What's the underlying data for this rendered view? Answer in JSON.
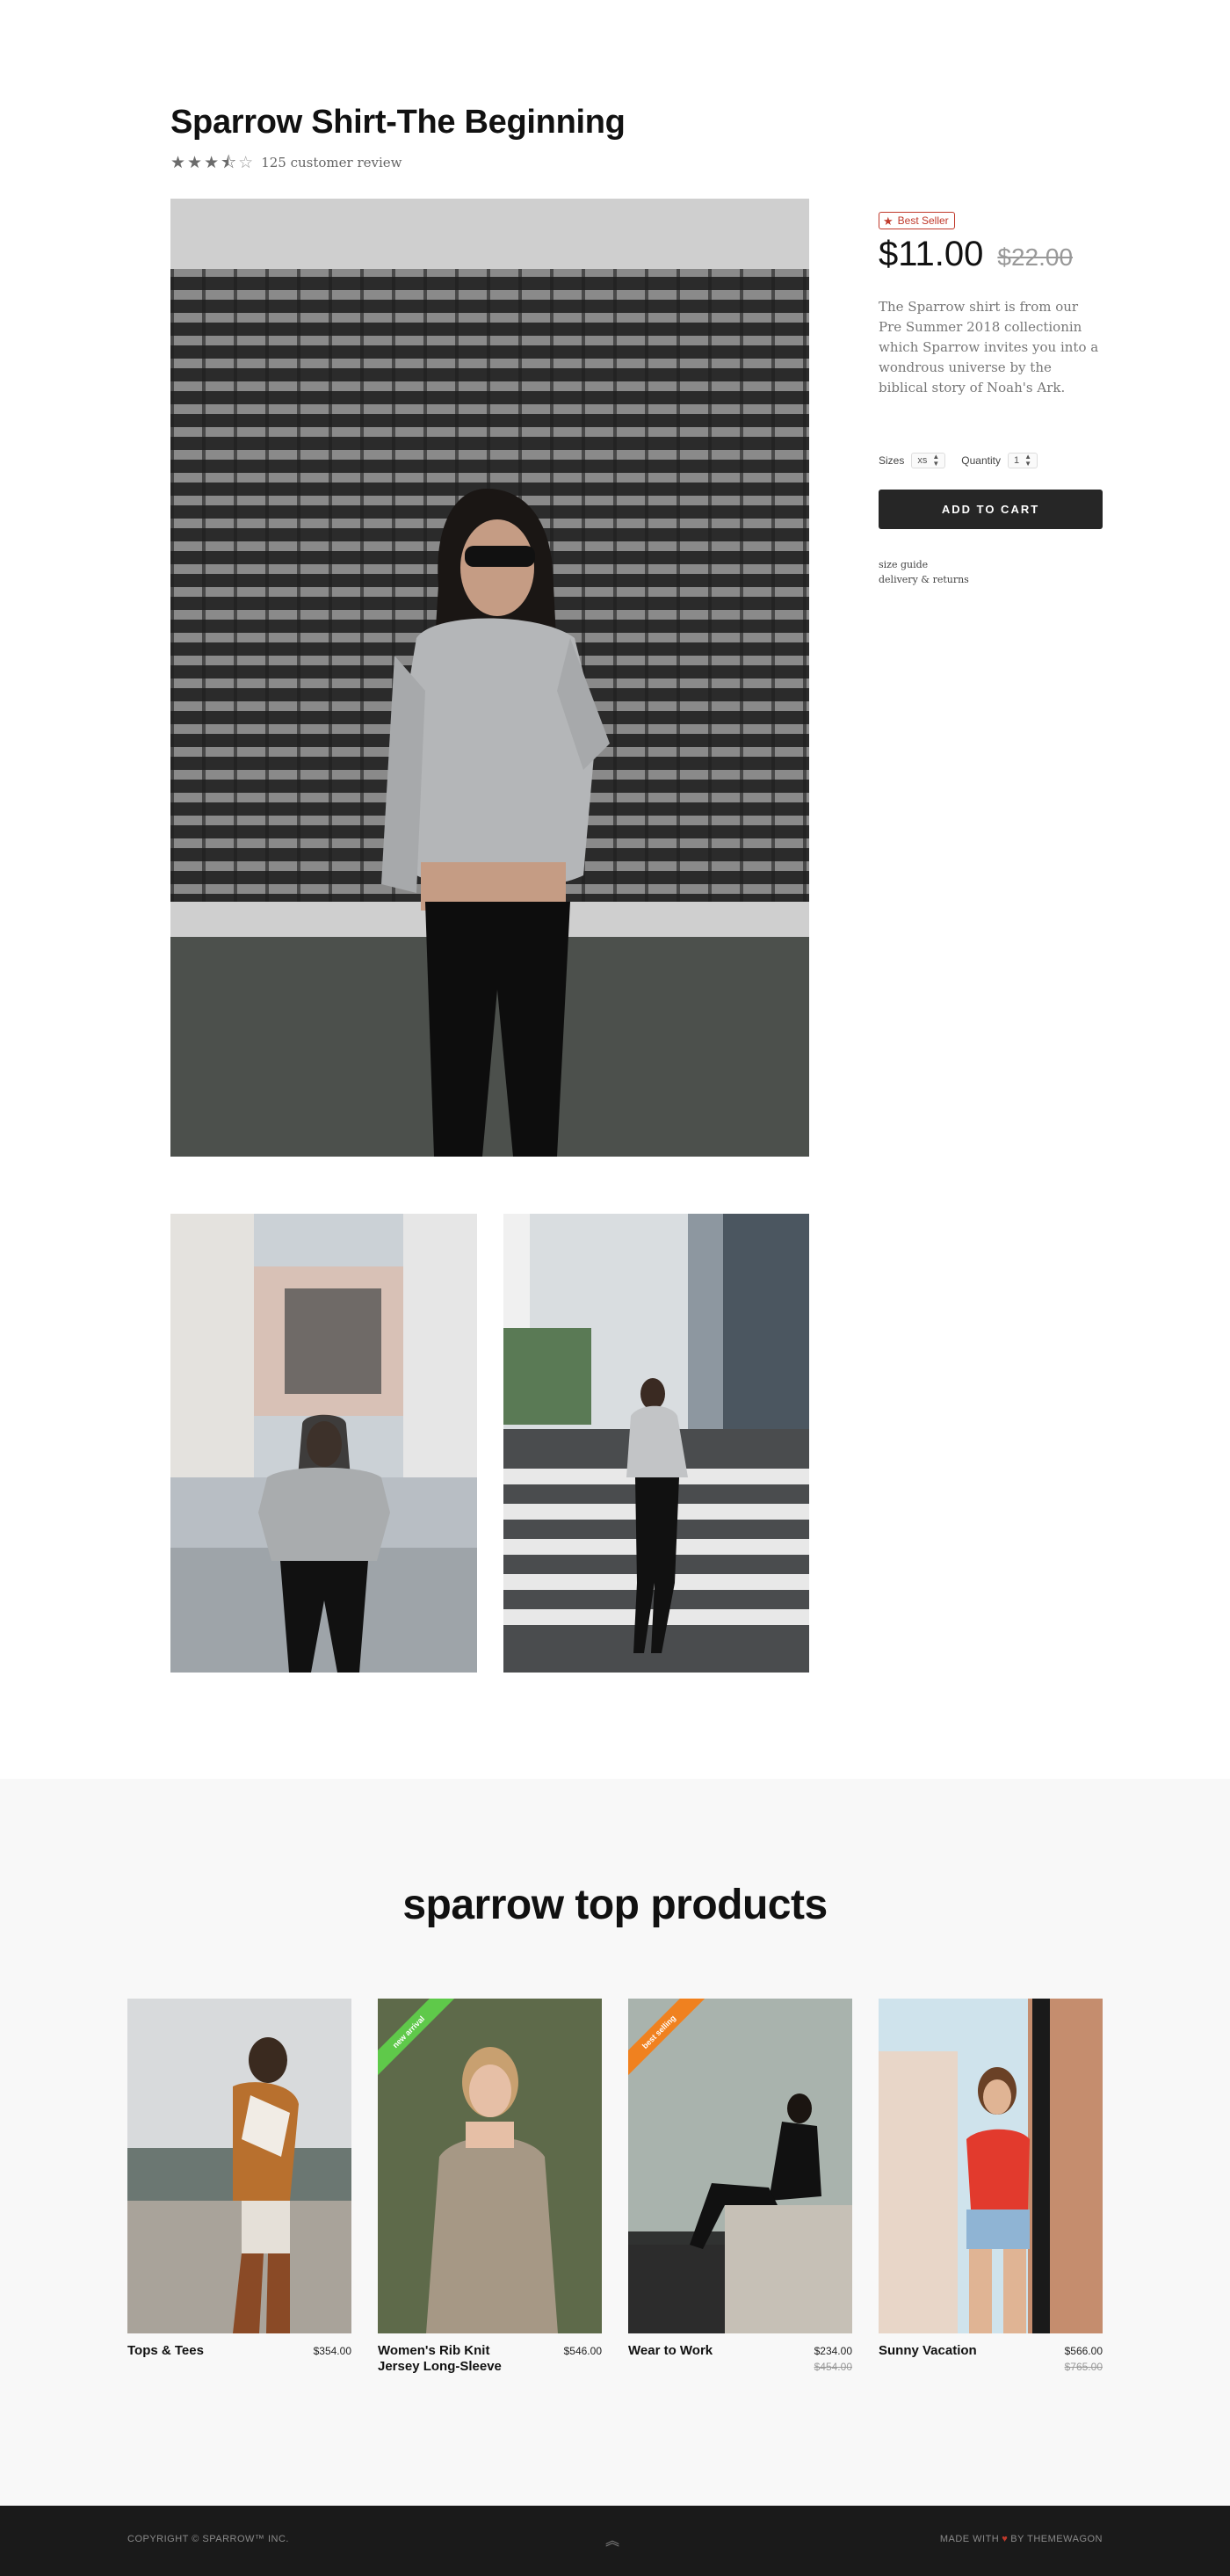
{
  "product": {
    "title": "Sparrow Shirt-The Beginning",
    "rating": 3.5,
    "rating_max": 5,
    "review_text": "125 customer review",
    "badge": "Best Seller",
    "price": "$11.00",
    "old_price": "$22.00",
    "description": "The Sparrow shirt is from our Pre Summer 2018 collectionin which Sparrow invites you into a wondrous universe by the biblical story of Noah's Ark.",
    "sizes_label": "Sizes",
    "size_value": "xs",
    "quantity_label": "Quantity",
    "quantity_value": "1",
    "add_to_cart": "ADD TO CART",
    "links": [
      "size guide",
      "delivery & returns"
    ]
  },
  "top_products": {
    "title": "sparrow top products",
    "items": [
      {
        "name": "Tops & Tees",
        "price": "$354.00",
        "old_price": "",
        "ribbon": ""
      },
      {
        "name": "Women's Rib Knit Jersey Long-Sleeve",
        "price": "$546.00",
        "old_price": "",
        "ribbon": "new arrival",
        "ribbon_color": "#5fc94a"
      },
      {
        "name": "Wear to Work",
        "price": "$234.00",
        "old_price": "$454.00",
        "ribbon": "best selling",
        "ribbon_color": "#f0811f"
      },
      {
        "name": "Sunny Vacation",
        "price": "$566.00",
        "old_price": "$765.00",
        "ribbon": ""
      }
    ]
  },
  "footer": {
    "copyright": "COPYRIGHT © SPARROW™ INC.",
    "made_with_prefix": "MADE WITH",
    "made_with_suffix": "BY THEMEWAGON",
    "back_to_top_icon": "chevron-double-up-icon"
  },
  "colors": {
    "accent_red": "#c0392b",
    "button_dark": "#262626",
    "footer_bg": "#1a1a1a",
    "section_bg": "#f8f8f8"
  }
}
